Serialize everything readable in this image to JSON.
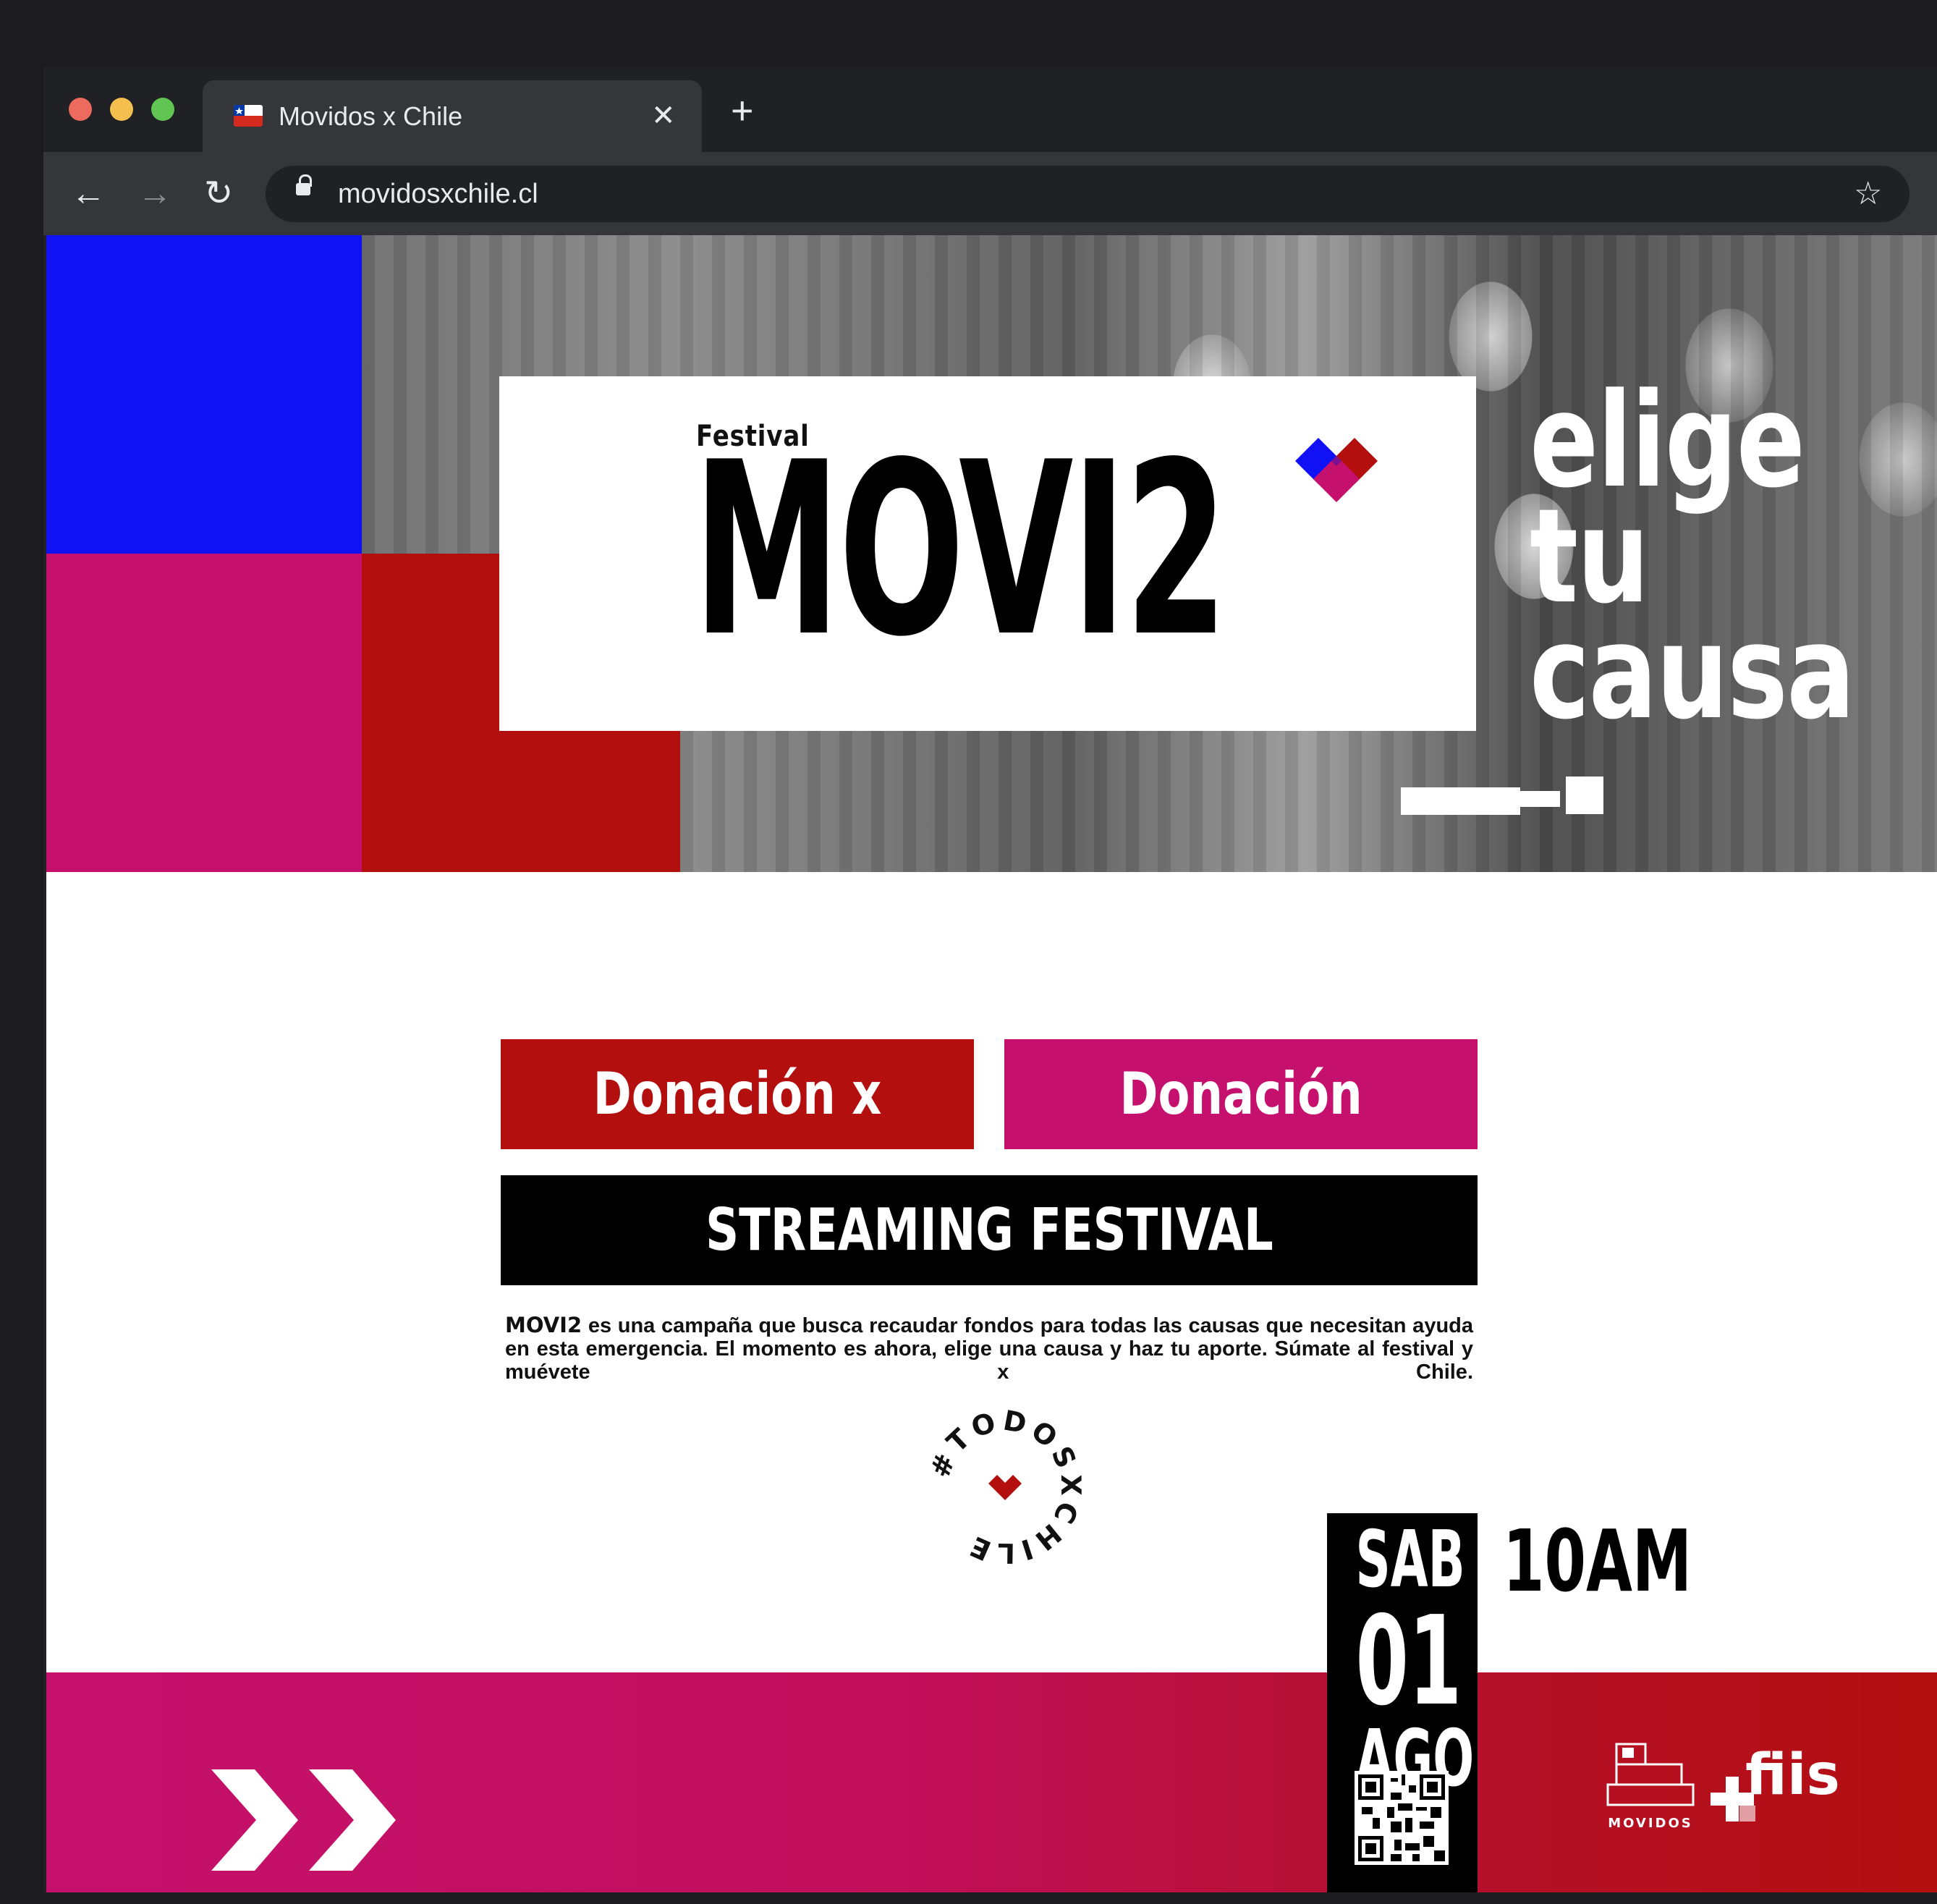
{
  "browser": {
    "tab_title": "Movidos x Chile",
    "close_glyph": "✕",
    "new_tab_glyph": "+",
    "url": "movidosxchile.cl",
    "nav": {
      "back": "←",
      "forward": "→",
      "reload": "↻",
      "star": "☆"
    }
  },
  "hero": {
    "festival_label": "Festival",
    "logo_text": "MOVI2",
    "tagline_lines": [
      "elige",
      "tu",
      "causa"
    ]
  },
  "buttons": {
    "donation_cause": "Donación x Causa",
    "donation_general": "Donación General",
    "streaming": "STREAMING FESTIVAL"
  },
  "description": {
    "brand": "MOVI2",
    "text": " es una campaña que busca recaudar fondos para todas las causas que necesitan ayuda en esta emergencia. El momento es ahora, elige una causa y haz tu aporte. Súmate al festival y muévete x Chile."
  },
  "badge": {
    "text": "#TODOSXCHILE"
  },
  "event": {
    "day": "SAB",
    "date": "01",
    "month": "AGO",
    "time": "10AM"
  },
  "footer": {
    "movidos_label": "MOVIDOS",
    "fiis_label": "fiis"
  },
  "colors": {
    "blue": "#1111f5",
    "magenta": "#c6106e",
    "red": "#b30f0f",
    "black": "#000000"
  }
}
